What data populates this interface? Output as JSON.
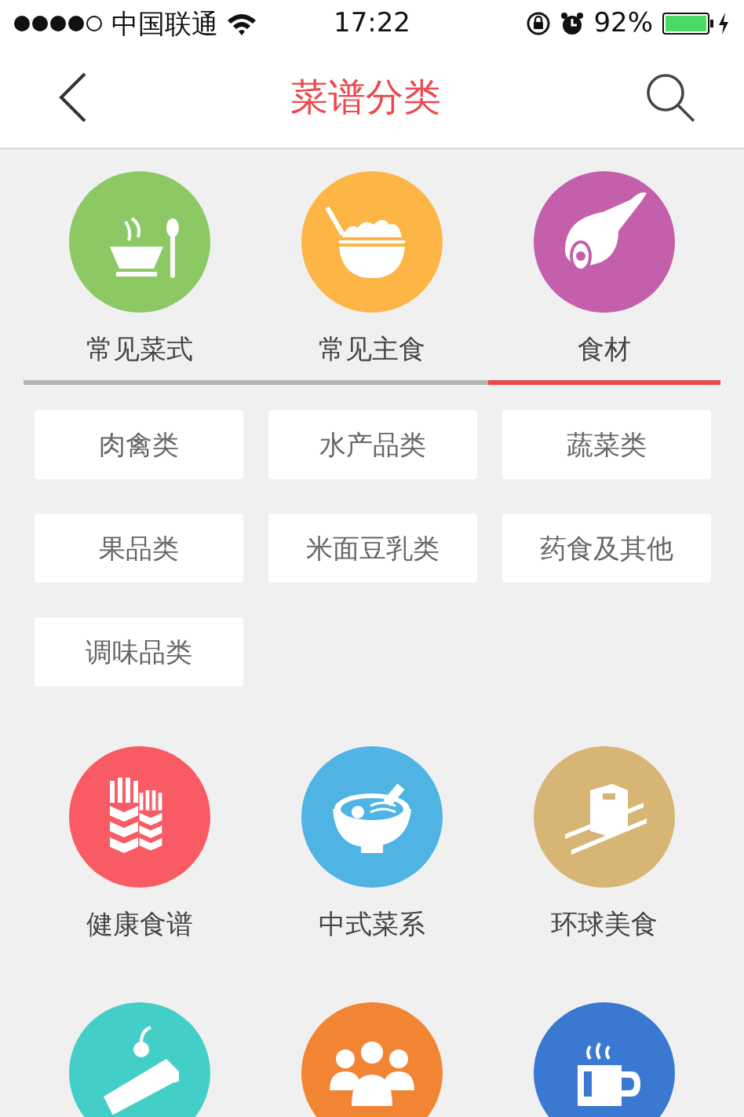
{
  "status_bar": {
    "carrier": "中国联通",
    "time": "17:22",
    "battery": "92%"
  },
  "nav": {
    "title": "菜谱分类"
  },
  "tabs": [
    {
      "label": "常见菜式",
      "color": "#8cc965",
      "selected": false
    },
    {
      "label": "常见主食",
      "color": "#fdb646",
      "selected": false
    },
    {
      "label": "食材",
      "color": "#c35fab",
      "selected": true
    }
  ],
  "chips": [
    "肉禽类",
    "水产品类",
    "蔬菜类",
    "果品类",
    "米面豆乳类",
    "药食及其他",
    "调味品类"
  ],
  "categories": [
    {
      "label": "健康食谱",
      "color": "#f85b63"
    },
    {
      "label": "中式菜系",
      "color": "#4fb3e4"
    },
    {
      "label": "环球美食",
      "color": "#d7b675"
    },
    {
      "color": "#43cfc7"
    },
    {
      "color": "#f28533"
    },
    {
      "color": "#3a79d2"
    }
  ]
}
